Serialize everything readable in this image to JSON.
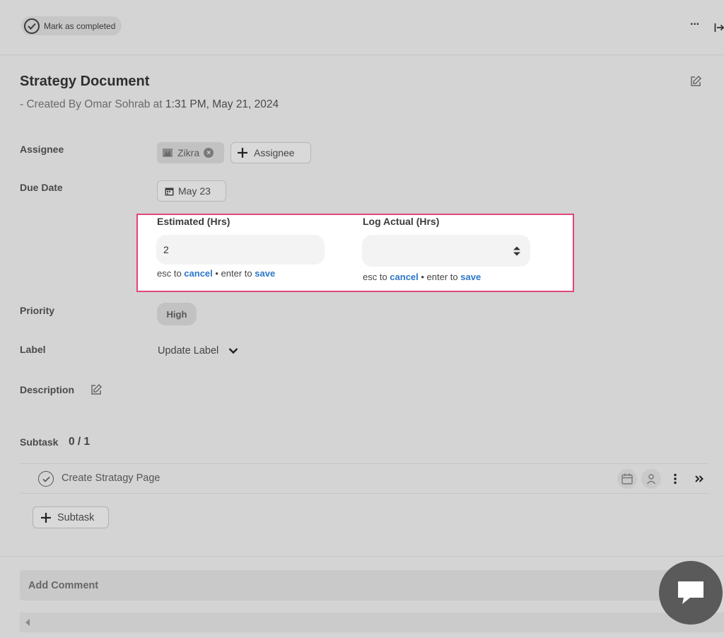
{
  "header": {
    "mark_completed_label": "Mark as completed",
    "more_label": "···"
  },
  "task": {
    "title": "Strategy Document",
    "created_prefix": "- Created By Omar Sohrab at ",
    "created_time": "1:31 PM, May 21, 2024"
  },
  "fields": {
    "assignee_label": "Assignee",
    "assignee_name": "Zikra",
    "add_assignee_label": "Assignee",
    "due_date_label": "Due Date",
    "due_date_value": "May 23",
    "estimated_label": "Estimated (Hrs)",
    "estimated_value": "2",
    "log_actual_label": "Log Actual (Hrs)",
    "log_actual_value": "",
    "hint_esc": "esc to ",
    "hint_cancel": "cancel",
    "hint_mid": " • enter to ",
    "hint_save": "save",
    "priority_label": "Priority",
    "priority_value": "High",
    "label_label": "Label",
    "label_value": "Update Label",
    "description_label": "Description"
  },
  "subtasks": {
    "label": "Subtask",
    "count": "0 / 1",
    "items": [
      {
        "name": "Create Stratagy Page"
      }
    ],
    "add_label": "Subtask"
  },
  "comment": {
    "placeholder": "Add Comment"
  },
  "colors": {
    "highlight_border": "#e0457b",
    "link": "#2c76c8"
  }
}
